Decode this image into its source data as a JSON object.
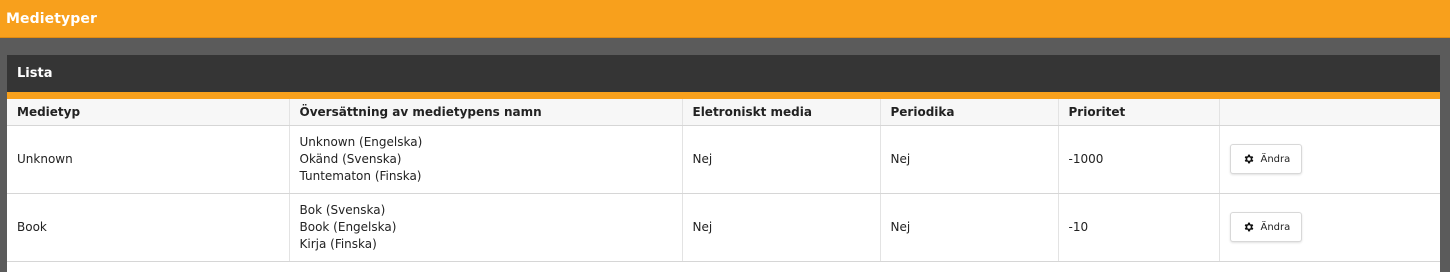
{
  "page": {
    "title": "Medietyper"
  },
  "panel": {
    "title": "Lista"
  },
  "table": {
    "headers": [
      "Medietyp",
      "Översättning av medietypens namn",
      "Eletroniskt media",
      "Periodika",
      "Prioritet",
      ""
    ],
    "rows": [
      {
        "medietyp": "Unknown",
        "names": [
          "Unknown (Engelska)",
          "Okänd (Svenska)",
          "Tuntematon (Finska)"
        ],
        "elektroniskt": "Nej",
        "periodika": "Nej",
        "prioritet": "-1000",
        "action_label": "Ändra"
      },
      {
        "medietyp": "Book",
        "names": [
          "Bok (Svenska)",
          "Book (Engelska)",
          "Kirja (Finska)"
        ],
        "elektroniskt": "Nej",
        "periodika": "Nej",
        "prioritet": "-10",
        "action_label": "Ändra"
      }
    ]
  },
  "icons": {
    "action": "gear-icon"
  },
  "colors": {
    "accent": "#f8a01c",
    "panel_header": "#353535",
    "background": "#5b5b5b"
  }
}
